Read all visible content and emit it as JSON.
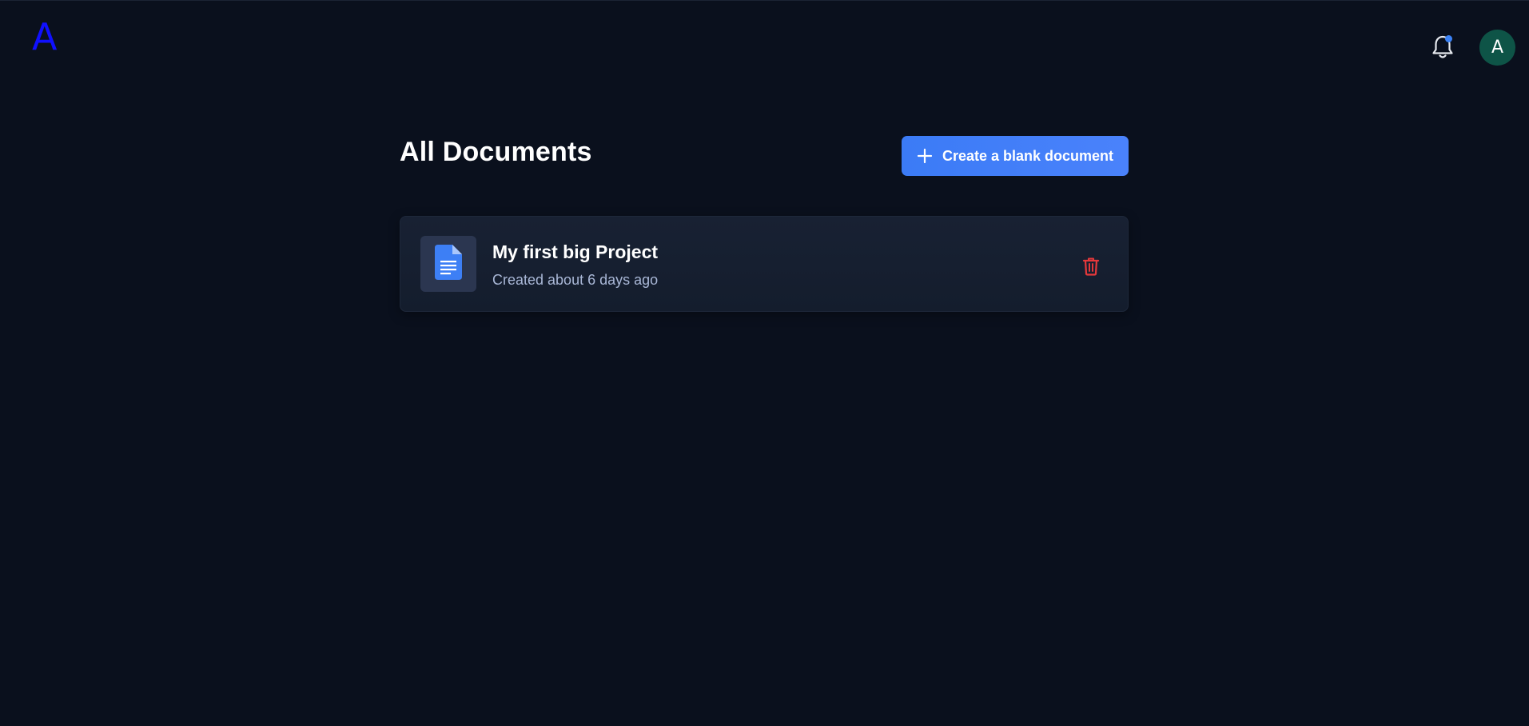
{
  "header": {
    "logo_text": "A",
    "notification_icon": "bell-icon",
    "notification_dot_color": "#3b82f6",
    "avatar_initial": "A",
    "avatar_color": "#0e5447"
  },
  "main": {
    "title": "All Documents",
    "create_button": {
      "label": "Create a blank document",
      "icon": "plus-icon",
      "color": "#3b7bf6"
    },
    "documents": [
      {
        "title": "My first big Project",
        "meta": "Created about 6 days ago",
        "icon": "document-icon",
        "action_icon": "trash-icon",
        "action_color": "#e5383b"
      }
    ]
  },
  "theme": {
    "background": "#0a101d",
    "card": "#182133"
  }
}
